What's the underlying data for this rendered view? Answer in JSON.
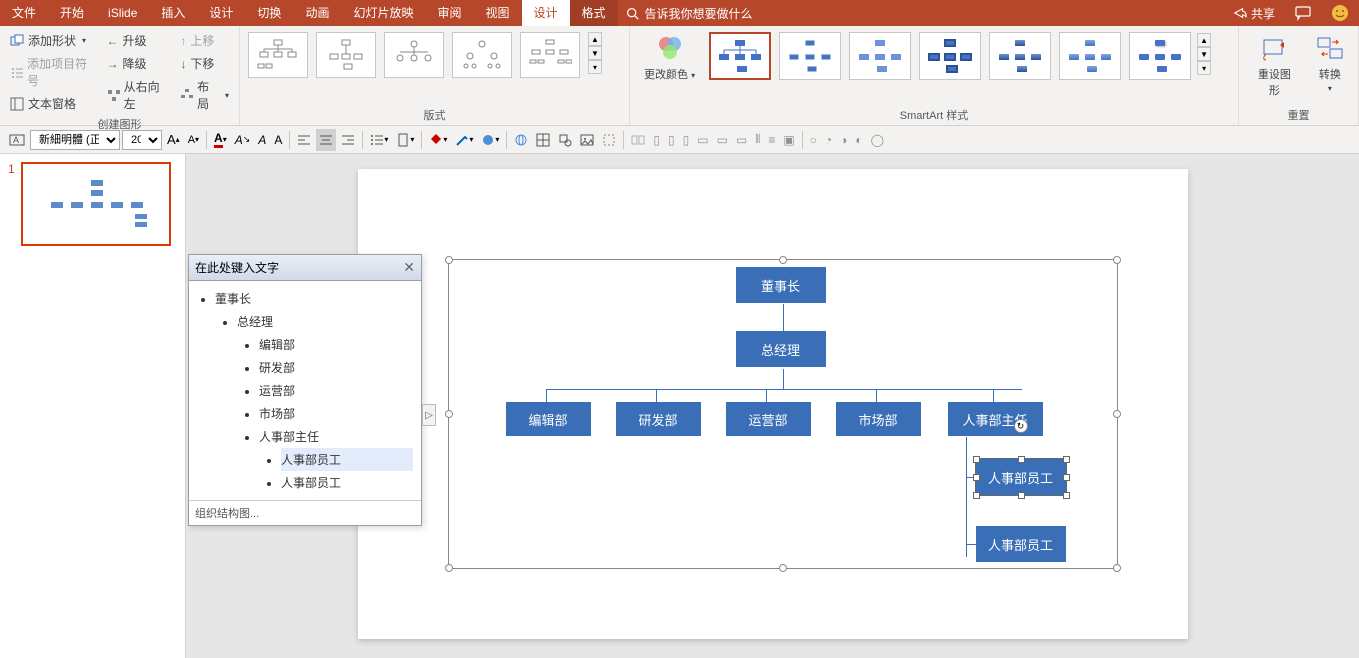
{
  "tabs": {
    "file": "文件",
    "home": "开始",
    "islide": "iSlide",
    "insert": "插入",
    "design_tab": "设计",
    "transitions": "切换",
    "animations": "动画",
    "slideshow": "幻灯片放映",
    "review": "审阅",
    "view": "视图",
    "design": "设计",
    "format": "格式"
  },
  "tell_me": "告诉我你想要做什么",
  "header_right": {
    "share": "共享"
  },
  "ribbon": {
    "create": {
      "add_shape": "添加形状",
      "add_bullet": "添加项目符号",
      "text_pane": "文本窗格",
      "promote": "升级",
      "demote": "降级",
      "rtl": "从右向左",
      "move_up": "上移",
      "move_down": "下移",
      "layout": "布局",
      "label": "创建图形"
    },
    "layout_label": "版式",
    "change_colors": "更改颜色",
    "styles_label": "SmartArt 样式",
    "reset": {
      "reset_graphic": "重设图形",
      "convert": "转换",
      "label": "重置"
    }
  },
  "toolbar": {
    "font": "新細明體 (正",
    "size": "20"
  },
  "thumbs": {
    "num": "1"
  },
  "text_pane": {
    "title": "在此处键入文字",
    "items": {
      "l1": "董事长",
      "l2": "总经理",
      "l3a": "编辑部",
      "l3b": "研发部",
      "l3c": "运营部",
      "l3d": "市场部",
      "l3e": "人事部主任",
      "l4a": "人事部员工",
      "l4b": "人事部员工"
    },
    "footer": "组织结构图..."
  },
  "chart_data": {
    "type": "org_chart",
    "nodes": [
      {
        "id": "n1",
        "label": "董事长",
        "parent": null
      },
      {
        "id": "n2",
        "label": "总经理",
        "parent": "n1"
      },
      {
        "id": "n3",
        "label": "编辑部",
        "parent": "n2"
      },
      {
        "id": "n4",
        "label": "研发部",
        "parent": "n2"
      },
      {
        "id": "n5",
        "label": "运营部",
        "parent": "n2"
      },
      {
        "id": "n6",
        "label": "市场部",
        "parent": "n2"
      },
      {
        "id": "n7",
        "label": "人事部主任",
        "parent": "n2"
      },
      {
        "id": "n8",
        "label": "人事部员工",
        "parent": "n7"
      },
      {
        "id": "n9",
        "label": "人事部员工",
        "parent": "n7"
      }
    ],
    "selected": "n8"
  }
}
